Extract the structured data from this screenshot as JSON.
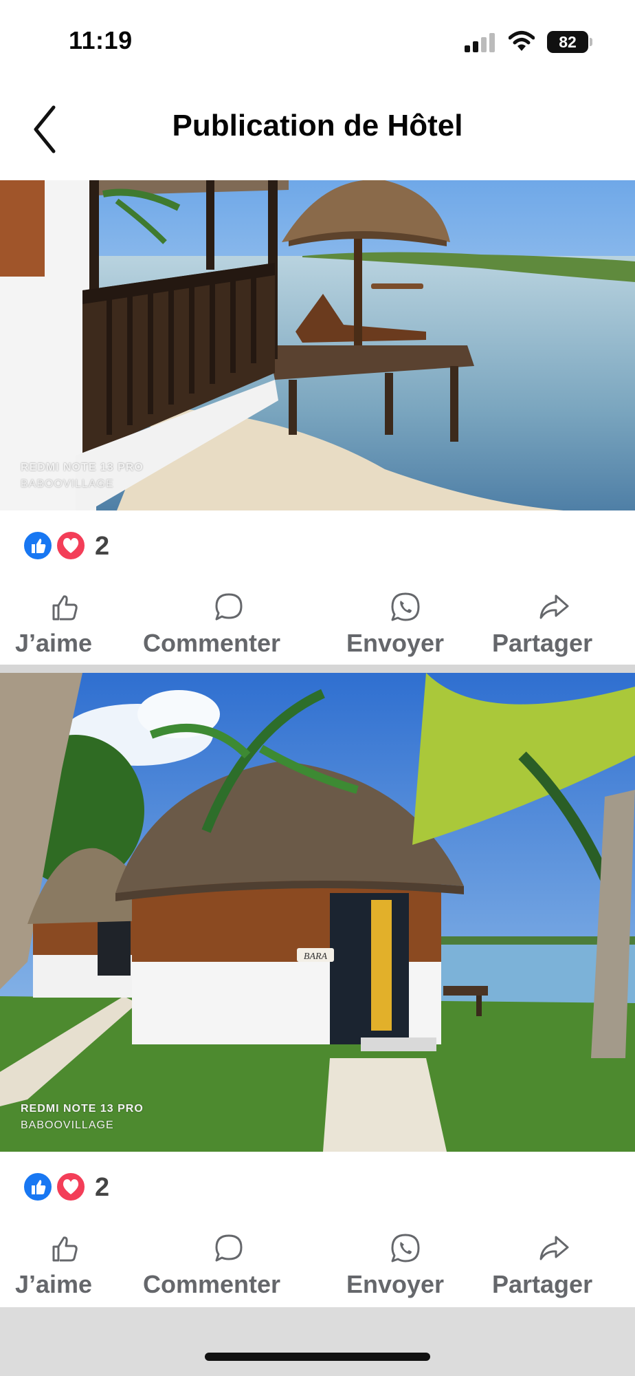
{
  "status_bar": {
    "time": "11:19",
    "battery": "82"
  },
  "header": {
    "title": "Publication de Hôtel"
  },
  "posts": [
    {
      "watermark_device": "REDMI NOTE 13 PRO",
      "watermark_owner": "BABOOVILLAGE",
      "reaction_count": "2",
      "actions": {
        "like": "J’aime",
        "comment": "Commenter",
        "send": "Envoyer",
        "share": "Partager"
      }
    },
    {
      "watermark_device": "REDMI NOTE 13 PRO",
      "watermark_owner": "BABOOVILLAGE",
      "sign_text": "BARA",
      "reaction_count": "2",
      "actions": {
        "like": "J’aime",
        "comment": "Commenter",
        "send": "Envoyer",
        "share": "Partager"
      }
    }
  ],
  "icons": {
    "back": "chevron-left-icon",
    "like": "thumbs-up-icon",
    "comment": "speech-bubble-icon",
    "send": "whatsapp-icon",
    "share": "share-arrow-icon"
  },
  "colors": {
    "like_blue": "#1877f2",
    "love_red": "#f33e58",
    "action_gray": "#65676b"
  }
}
